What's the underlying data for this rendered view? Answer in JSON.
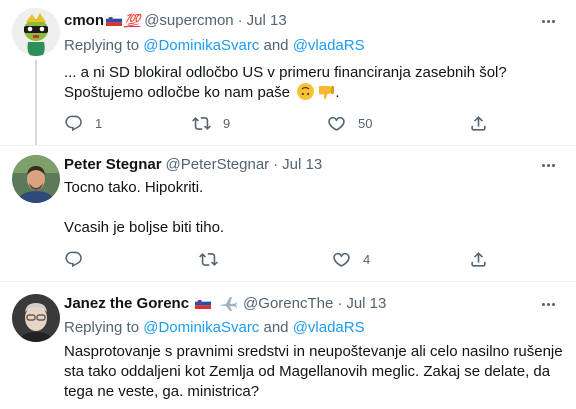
{
  "tweets": [
    {
      "name": "cmon",
      "handle": "@supercmon",
      "dot": "·",
      "date": "Jul 13",
      "badge_100": "💯",
      "replying_prefix": "Replying to ",
      "mention1": "@DominikaSvarc",
      "and_text": " and ",
      "mention2": "@vladaRS",
      "line1": "... a ni SD blokiral odločbo US v primeru financiranja zasebnih šol?",
      "line2": "Spoštujemo odločbe ko nam paše",
      "emoji": [
        "upside-down-face",
        "thumbs-down"
      ],
      "line2_end": ".",
      "replies": "1",
      "retweets": "9",
      "likes": "50"
    },
    {
      "name": "Peter Stegnar",
      "handle": "@PeterStegnar",
      "dot": "·",
      "date": "Jul 13",
      "line1": "Tocno tako. Hipokriti.",
      "line2": "Vcasih je boljse biti tiho.",
      "replies": "",
      "retweets": "",
      "likes": "4"
    },
    {
      "name": "Janez the Gorenc",
      "handle": "@GorencThe",
      "dot": "·",
      "date": "Jul 13",
      "replying_prefix": "Replying to ",
      "mention1": "@DominikaSvarc",
      "and_text": " and ",
      "mention2": "@vladaRS",
      "line1": "Nasprotovanje s pravnimi sredstvi in neupoštevanje ali celo nasilno rušenje",
      "line2": "sta tako oddaljeni kot Zemlja od Magellanovih meglic. Zakaj se delate, da",
      "line3": "tega ne veste, ga. ministrica?"
    }
  ],
  "colors": {
    "text": "#0f1419",
    "secondary": "#536471",
    "link": "#1d9bf0",
    "divider": "#eff3f4"
  },
  "icons": [
    "reply-icon",
    "retweet-icon",
    "like-icon",
    "share-icon",
    "more-icon",
    "slovenia-flag-icon",
    "airplane-icon"
  ]
}
